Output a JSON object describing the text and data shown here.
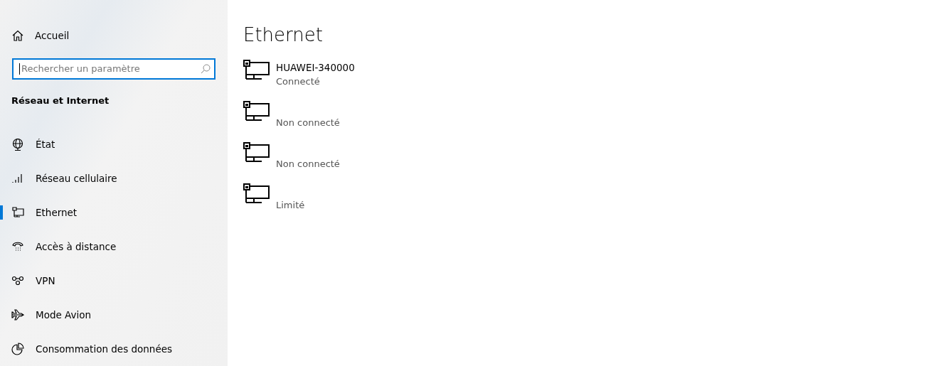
{
  "sidebar": {
    "home": {
      "label": "Accueil"
    },
    "search": {
      "placeholder": "Rechercher un paramètre",
      "focused": true
    },
    "section_title": "Réseau et Internet",
    "items": [
      {
        "label": "État",
        "selected": false
      },
      {
        "label": "Réseau cellulaire",
        "selected": false
      },
      {
        "label": "Ethernet",
        "selected": true
      },
      {
        "label": "Accès à distance",
        "selected": false
      },
      {
        "label": "VPN",
        "selected": false
      },
      {
        "label": "Mode Avion",
        "selected": false
      },
      {
        "label": "Consommation des données",
        "selected": false
      }
    ]
  },
  "main": {
    "title": "Ethernet",
    "adapters": [
      {
        "name": "HUAWEI-340000",
        "status": "Connecté"
      },
      {
        "status": "Non connecté"
      },
      {
        "status": "Non connecté"
      },
      {
        "status": "Limité"
      }
    ]
  }
}
